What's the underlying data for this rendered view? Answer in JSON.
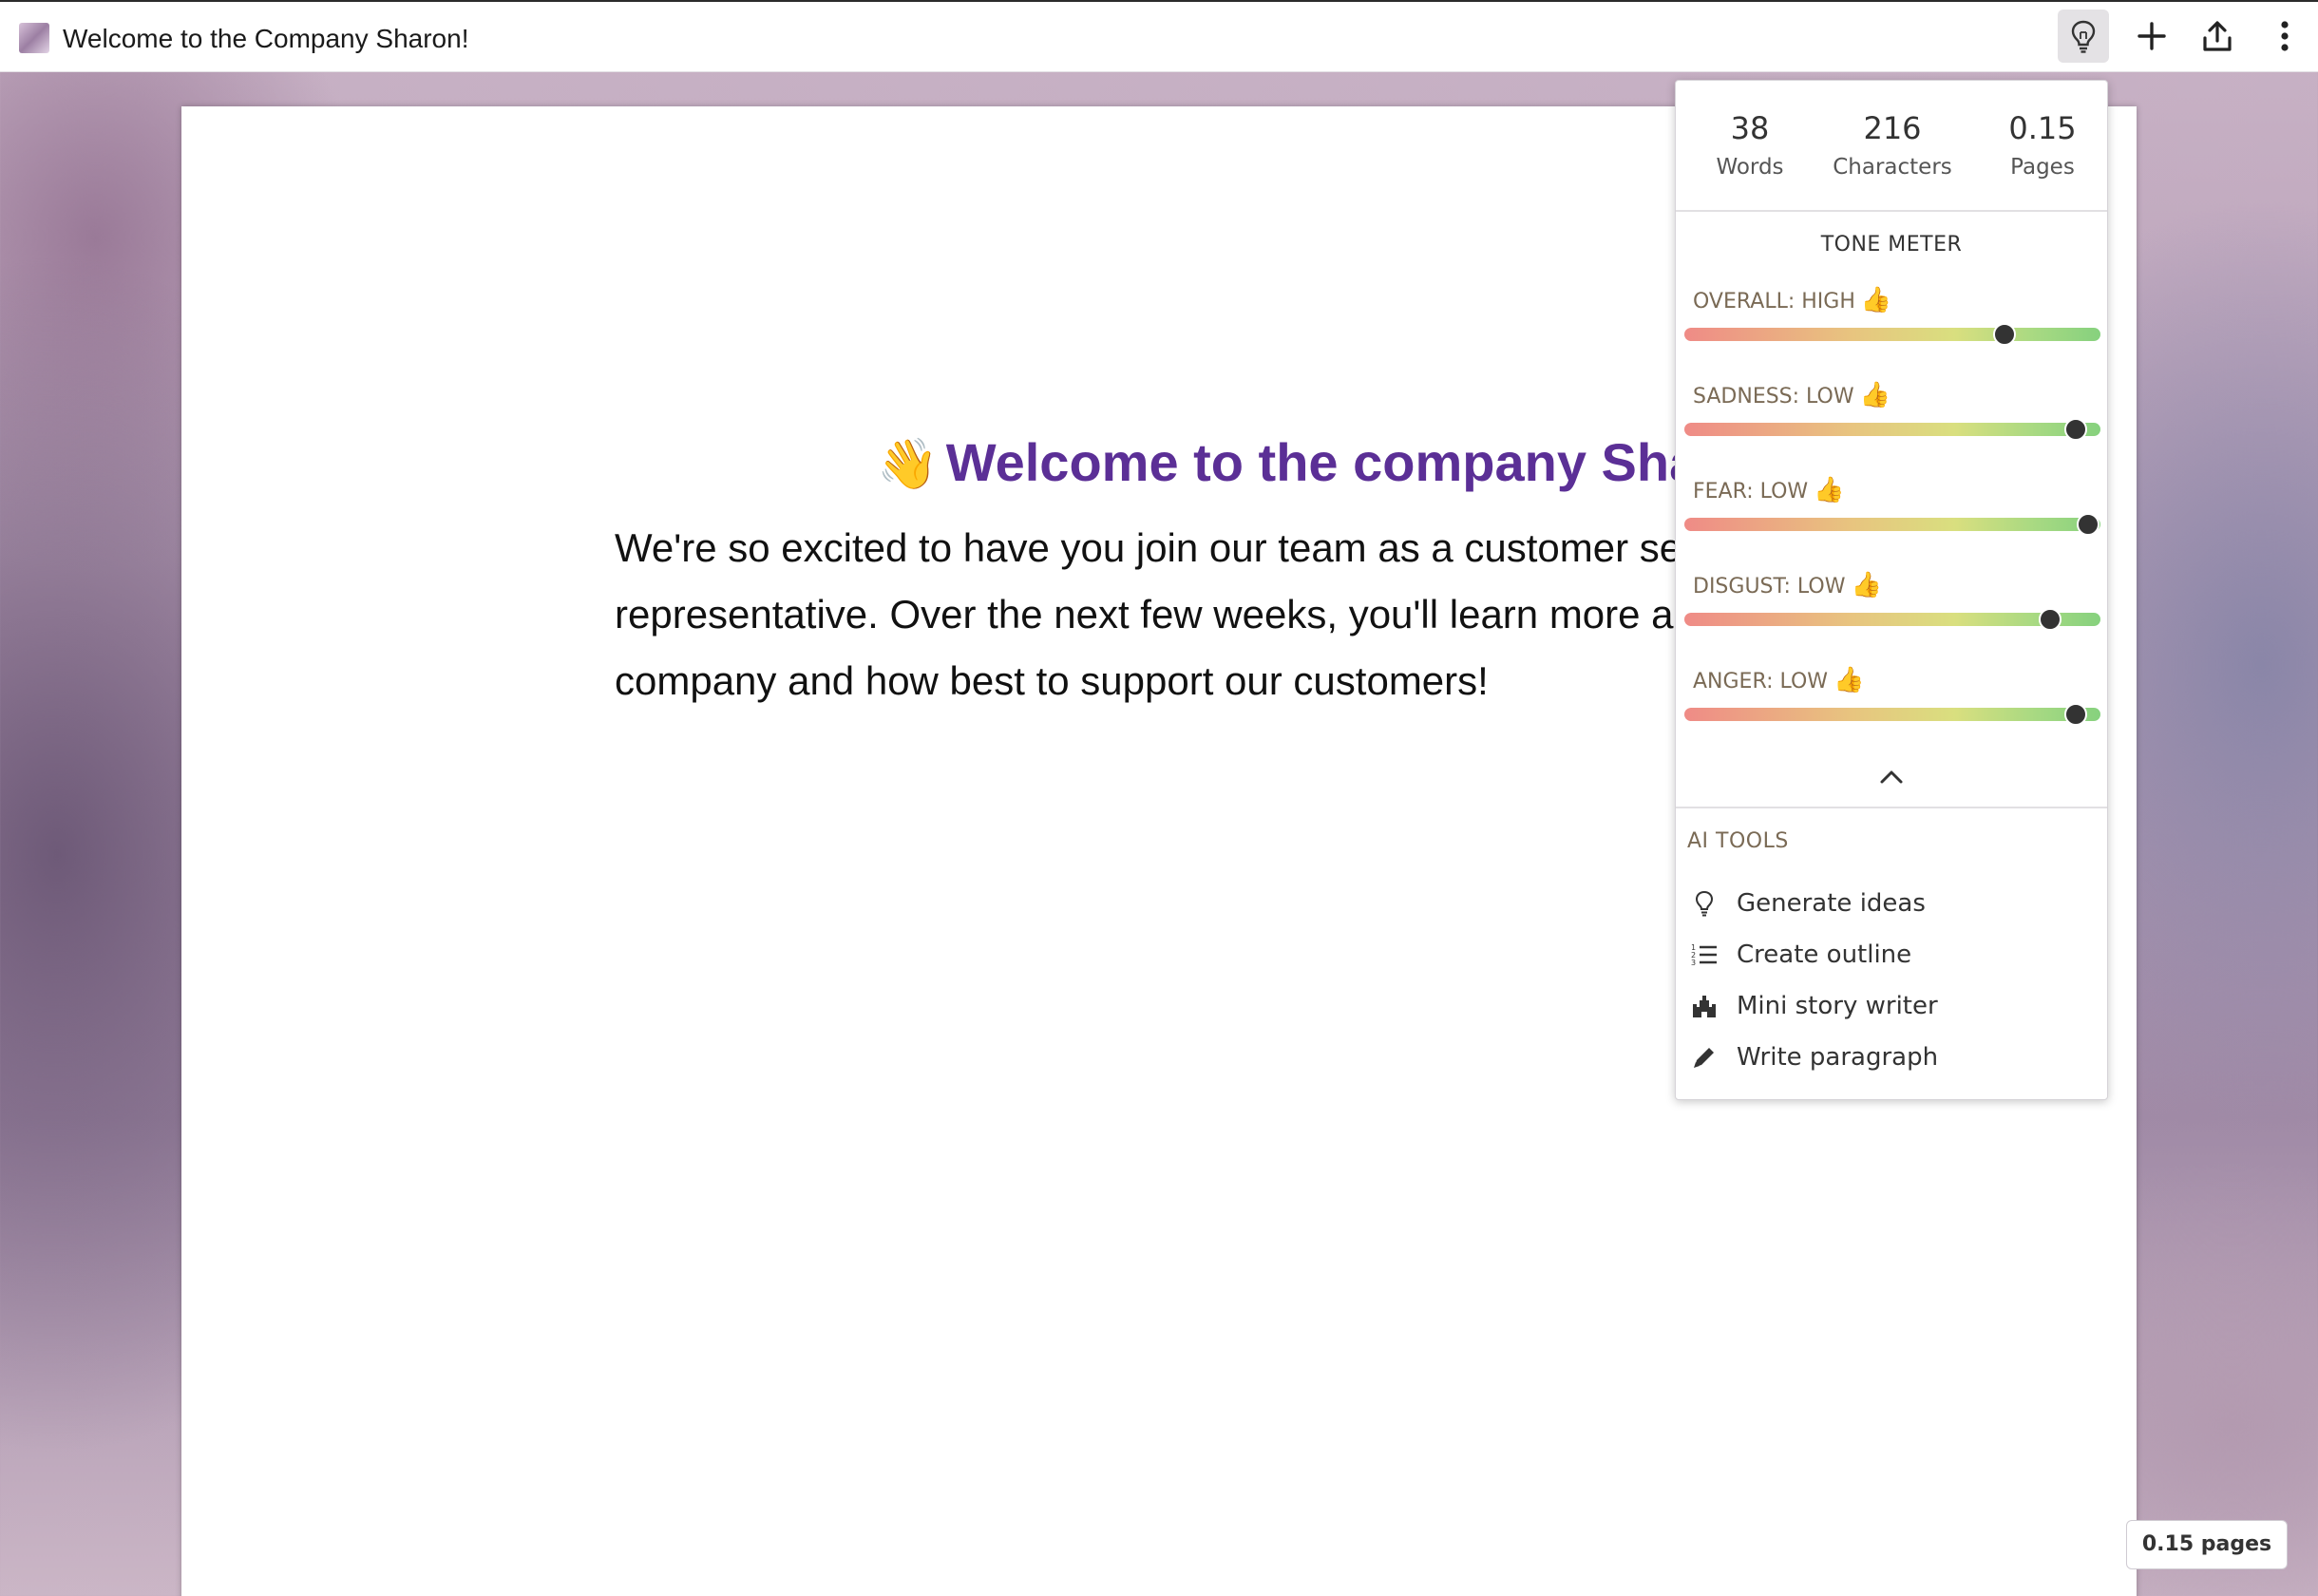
{
  "window": {
    "title": "Welcome to the Company Sharon!"
  },
  "toolbar": {
    "buttons": [
      "lightbulb-icon",
      "plus-icon",
      "share-icon",
      "more-vert-icon"
    ]
  },
  "document": {
    "heading_emoji": "👋",
    "heading": "Welcome to the company Sharon!",
    "body": "We're so excited to have you join our team as a customer service representative. Over the next few weeks, you'll learn more about our company and how best to support our customers!"
  },
  "panel": {
    "stats": [
      {
        "value": "38",
        "label": "Words"
      },
      {
        "value": "216",
        "label": "Characters"
      },
      {
        "value": "0.15",
        "label": "Pages"
      }
    ],
    "tone_meter_title": "TONE METER",
    "tones": [
      {
        "label": "OVERALL: HIGH",
        "emoji": "👍",
        "level": 0.77
      },
      {
        "label": "SADNESS: LOW",
        "emoji": "👍",
        "level": 0.94
      },
      {
        "label": "FEAR: LOW",
        "emoji": "👍",
        "level": 0.97
      },
      {
        "label": "DISGUST: LOW",
        "emoji": "👍",
        "level": 0.88
      },
      {
        "label": "ANGER: LOW",
        "emoji": "👍",
        "level": 0.94
      }
    ],
    "ai_tools_title": "AI TOOLS",
    "ai_tools": [
      {
        "label": "Generate ideas",
        "icon": "lightbulb-icon"
      },
      {
        "label": "Create outline",
        "icon": "numbered-list-icon"
      },
      {
        "label": "Mini story writer",
        "icon": "castle-icon"
      },
      {
        "label": "Write paragraph",
        "icon": "pencil-icon"
      }
    ]
  },
  "footer": {
    "pages_badge": "0.15 pages"
  },
  "colors": {
    "heading": "#5b2f96",
    "meter_low": "#ef8b86",
    "meter_mid": "#d9df7f",
    "meter_high": "#86d17e"
  }
}
